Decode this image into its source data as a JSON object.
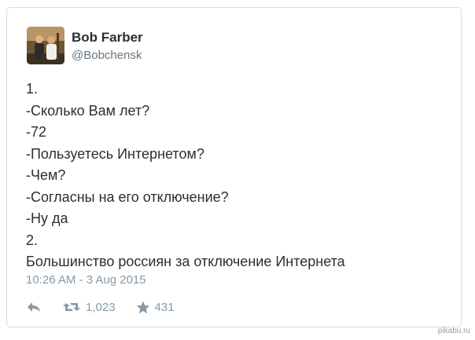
{
  "author": {
    "display_name": "Bob Farber",
    "handle": "@Bobchensk"
  },
  "tweet": {
    "lines": [
      "1.",
      "-Сколько Вам лет?",
      "-72",
      "-Пользуетесь Интернетом?",
      "-Чем?",
      "-Согласны на его отключение?",
      "-Ну да",
      "2.",
      "Большинство россиян за отключение Интернета"
    ],
    "timestamp": "10:26 AM - 3 Aug 2015"
  },
  "actions": {
    "reply_icon": "reply-icon",
    "retweet_icon": "retweet-icon",
    "retweet_count": "1,023",
    "favorite_icon": "star-icon",
    "favorite_count": "431"
  },
  "watermark": "pikabu.ru",
  "colors": {
    "text": "#292f33",
    "secondary": "#66757f",
    "muted": "#8899a6",
    "border": "#dcdcdc"
  }
}
